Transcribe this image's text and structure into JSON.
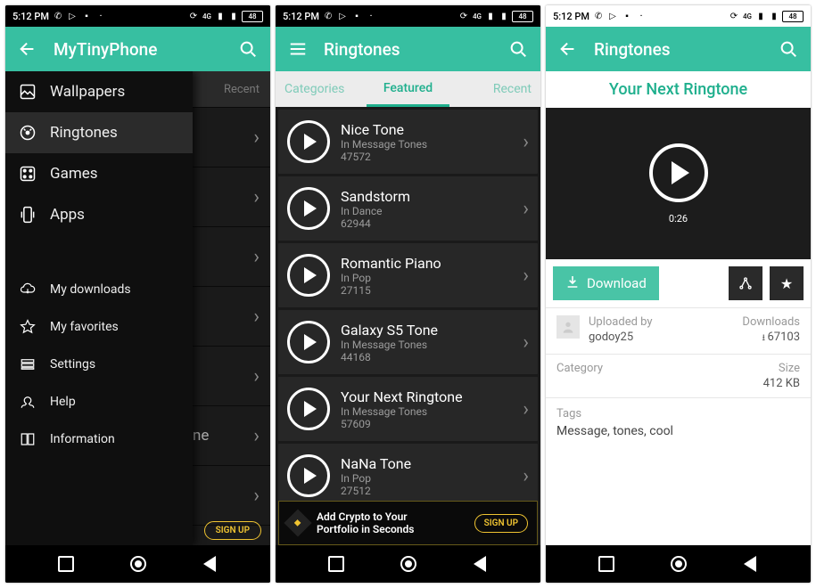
{
  "status": {
    "time": "5:12 PM",
    "battery": "48"
  },
  "screen1": {
    "appbar_title": "MyTinyPhone",
    "bg_tab_hint": "Recent",
    "bg_item_fragment": "ne",
    "bg_signup": "SIGN UP",
    "drawer": {
      "items": [
        {
          "label": "Wallpapers"
        },
        {
          "label": "Ringtones"
        },
        {
          "label": "Games"
        },
        {
          "label": "Apps"
        }
      ],
      "secondary": [
        {
          "label": "My downloads"
        },
        {
          "label": "My favorites"
        },
        {
          "label": "Settings"
        },
        {
          "label": "Help"
        },
        {
          "label": "Information"
        }
      ]
    }
  },
  "screen2": {
    "appbar_title": "Ringtones",
    "tabs": {
      "categories": "Categories",
      "featured": "Featured",
      "recent": "Recent"
    },
    "items": [
      {
        "title": "Nice Tone",
        "sub": "In Message Tones",
        "count": "47572"
      },
      {
        "title": "Sandstorm",
        "sub": "In Dance",
        "count": "62944"
      },
      {
        "title": "Romantic Piano",
        "sub": "In Pop",
        "count": "27115"
      },
      {
        "title": "Galaxy S5 Tone",
        "sub": "In Message Tones",
        "count": "44168"
      },
      {
        "title": "Your Next Ringtone",
        "sub": "In Message Tones",
        "count": "57609"
      },
      {
        "title": "NaNa Tone",
        "sub": "In Pop",
        "count": "27512"
      }
    ],
    "ad": {
      "line1": "Add Crypto to Your",
      "line2": "Portfolio in Seconds",
      "cta": "SIGN UP"
    }
  },
  "screen3": {
    "appbar_title": "Ringtones",
    "title": "Your Next Ringtone",
    "duration": "0:26",
    "download": "Download",
    "uploaded_lbl": "Uploaded by",
    "uploader": "godoy25",
    "downloads_lbl": "Downloads",
    "downloads": "67103",
    "category_lbl": "Category",
    "size_lbl": "Size",
    "size": "412 KB",
    "tags_lbl": "Tags",
    "tags": "Message, tones, cool"
  }
}
